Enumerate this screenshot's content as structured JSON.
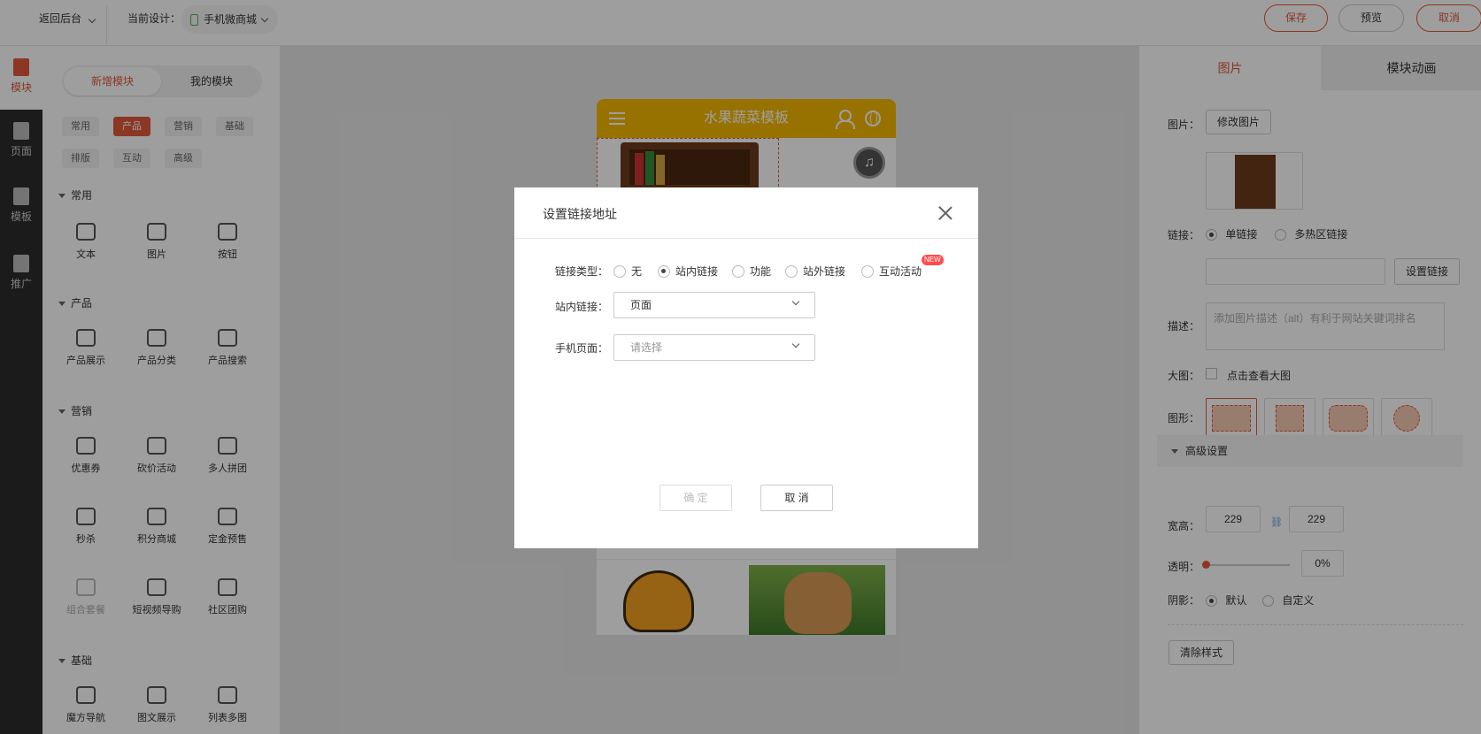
{
  "topbar": {
    "back": "返回后台",
    "current_design_label": "当前设计：",
    "current_design_value": "手机微商城",
    "save": "保存",
    "preview": "预览",
    "cancel": "取消"
  },
  "rail": {
    "items": [
      {
        "label": "模块",
        "icon": "module-icon"
      },
      {
        "label": "页面",
        "icon": "page-icon"
      },
      {
        "label": "模板",
        "icon": "template-icon"
      },
      {
        "label": "推广",
        "icon": "megaphone-icon"
      }
    ]
  },
  "modules": {
    "tab_new": "新增模块",
    "tab_mine": "我的模块",
    "chips": [
      "常用",
      "产品",
      "营销",
      "基础",
      "排版",
      "互动",
      "高级"
    ],
    "groups": {
      "common": "常用",
      "product": "产品",
      "marketing": "营销",
      "basic": "基础"
    },
    "common_tools": [
      "文本",
      "图片",
      "按钮"
    ],
    "product_tools": [
      "产品展示",
      "产品分类",
      "产品搜索"
    ],
    "marketing_tools_1": [
      "优惠券",
      "砍价活动",
      "多人拼团"
    ],
    "marketing_tools_2": [
      "秒杀",
      "积分商城",
      "定金预售"
    ],
    "marketing_tools_3": [
      "组合套餐",
      "短视频导购",
      "社区团购"
    ],
    "basic_tools": [
      "魔方导航",
      "图文展示",
      "列表多图"
    ]
  },
  "phone": {
    "title": "水果蔬菜模板",
    "music_glyph": "♫"
  },
  "right_panel": {
    "tab_image": "图片",
    "tab_animation": "模块动画",
    "image_label": "图片：",
    "change_image": "修改图片",
    "link_label": "链接：",
    "single_link": "单链接",
    "multi_hotspot": "多热区链接",
    "set_link": "设置链接",
    "desc_label": "描述：",
    "desc_placeholder": "添加图片描述（alt）有利于网站关键词排名",
    "big_image_label": "大图：",
    "big_image_check": "点击查看大图",
    "shape_label": "图形：",
    "advanced": "高级设置",
    "size_label": "宽高：",
    "width": "229",
    "height": "229",
    "opacity_label": "透明：",
    "opacity_value": "0%",
    "shadow_label": "阴影：",
    "shadow_default": "默认",
    "shadow_custom": "自定义",
    "clear_style": "清除样式"
  },
  "modal": {
    "title": "设置链接地址",
    "link_type_label": "链接类型：",
    "link_types": [
      "无",
      "站内链接",
      "功能",
      "站外链接",
      "互动活动"
    ],
    "new_badge": "NEW",
    "internal_link_label": "站内链接：",
    "internal_link_value": "页面",
    "mobile_page_label": "手机页面：",
    "mobile_page_placeholder": "请选择",
    "ok": "确 定",
    "cancel": "取 消"
  },
  "colors": {
    "accent": "#e05a3a",
    "phone_header": "#f5b800",
    "rail": "#2c2c2c"
  }
}
